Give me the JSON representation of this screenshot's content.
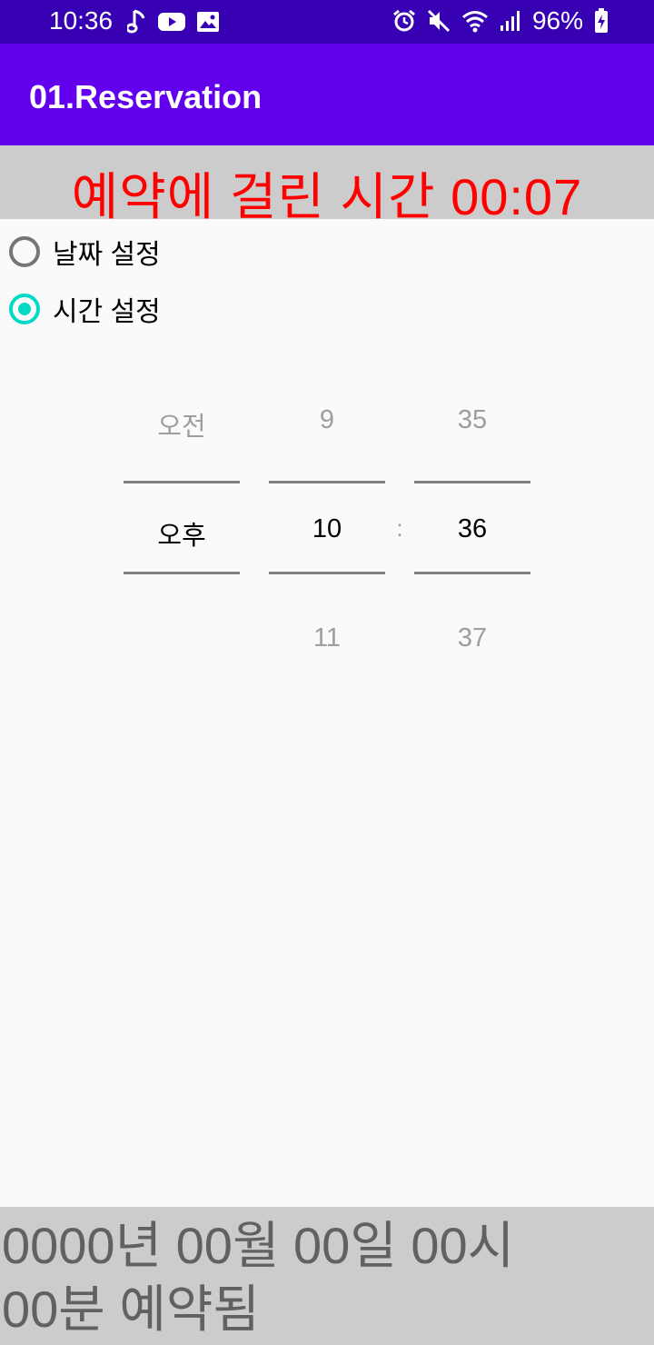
{
  "status_bar": {
    "time": "10:36",
    "battery": "96%",
    "left_icons": [
      "music-note-icon",
      "youtube-icon",
      "image-icon"
    ],
    "right_icons": [
      "alarm-icon",
      "mute-icon",
      "wifi-icon",
      "signal-icon",
      "battery-charging-icon"
    ]
  },
  "app_bar": {
    "title": "01.Reservation",
    "color": "#6200ee"
  },
  "elapsed": {
    "text": "예약에 걸린 시간 00:07",
    "color": "#ff0000"
  },
  "radios": {
    "date": {
      "label": "날짜 설정",
      "checked": false
    },
    "time": {
      "label": "시간 설정",
      "checked": true
    }
  },
  "time_picker": {
    "ampm": {
      "prev": "오전",
      "current": "오후",
      "next": ""
    },
    "hour": {
      "prev": "9",
      "current": "10",
      "next": "11"
    },
    "separator": ":",
    "minute": {
      "prev": "35",
      "current": "36",
      "next": "37"
    }
  },
  "result": {
    "text": "0000년 00월 00일 00시 00분 예약됨"
  },
  "colors": {
    "accent": "#03dac5",
    "status_bar": "#3700b3",
    "panel": "#cccccc"
  }
}
